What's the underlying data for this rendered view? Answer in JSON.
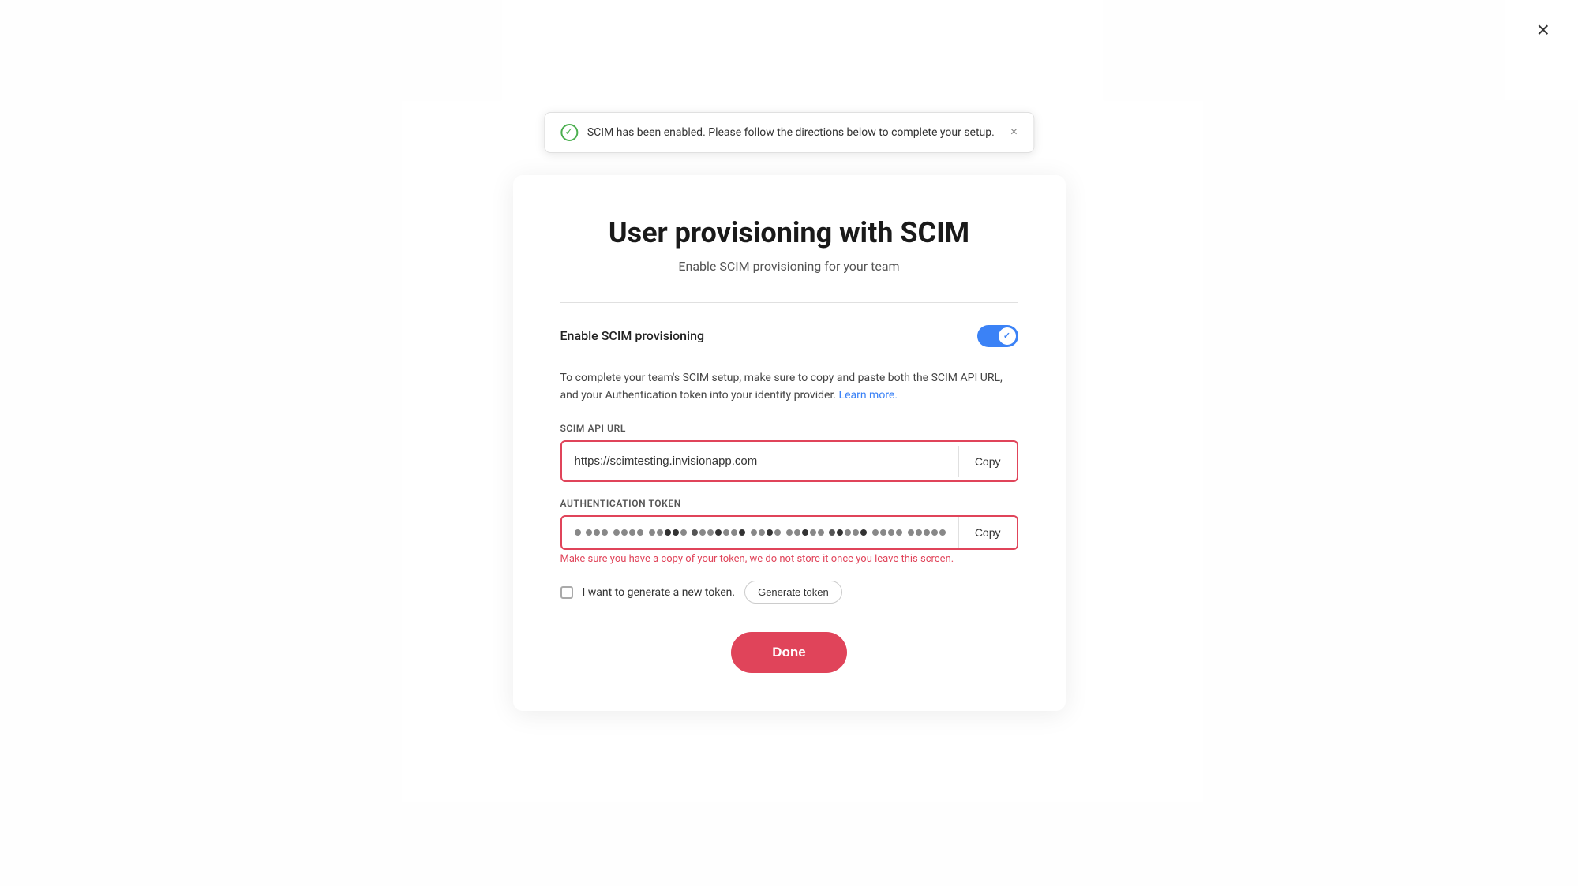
{
  "modal": {
    "title": "User provisioning with SCIM",
    "subtitle": "Enable SCIM provisioning for your team",
    "close_label": "×"
  },
  "toast": {
    "message": "SCIM has been enabled. Please follow the directions below to complete your setup.",
    "close_label": "×"
  },
  "toggle": {
    "label": "Enable SCIM provisioning",
    "enabled": true
  },
  "description": {
    "text_before_link": "To complete your team's SCIM setup, make sure to copy and paste both the SCIM API URL, and your Authentication token into your identity provider.",
    "link_label": "Learn more.",
    "text_after_link": ""
  },
  "scim_api_url": {
    "label": "SCIM API URL",
    "value": "https://scimtesting.invisionapp.com",
    "copy_label": "Copy"
  },
  "auth_token": {
    "label": "Authentication token",
    "copy_label": "Copy",
    "warning": "Make sure you have a copy of your token, we do not store it once you leave this screen."
  },
  "new_token": {
    "label": "I want to generate a new token.",
    "generate_label": "Generate token"
  },
  "done_button": {
    "label": "Done"
  }
}
